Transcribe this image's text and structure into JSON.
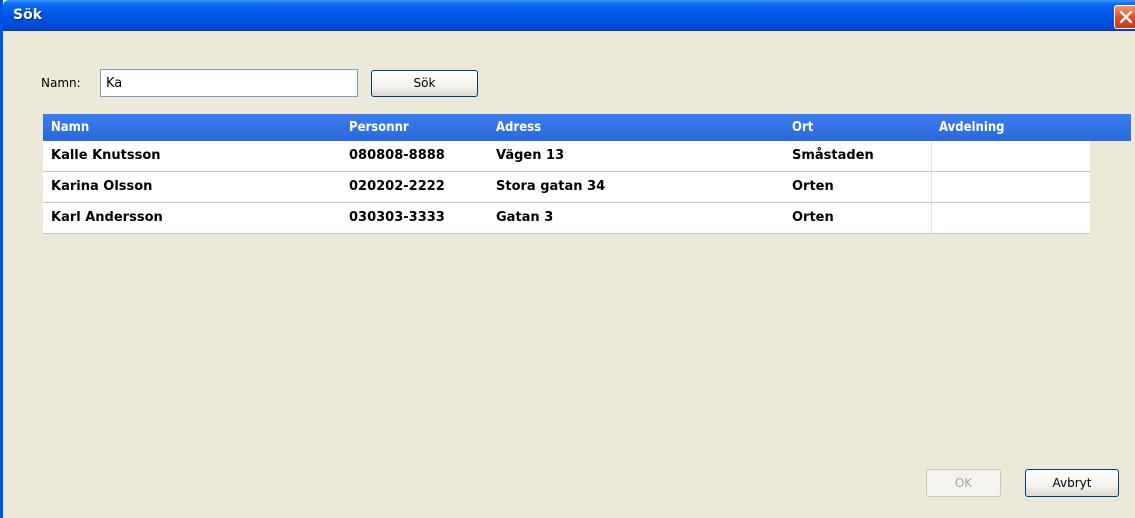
{
  "window": {
    "title": "Sök"
  },
  "search": {
    "label": "Namn:",
    "value": "Ka",
    "button_label": "Sök"
  },
  "table": {
    "columns": [
      "Namn",
      "Personnr",
      "Adress",
      "Ort",
      "Avdelning"
    ],
    "rows": [
      [
        "Kalle Knutsson",
        "080808-8888",
        "Vägen 13",
        "Småstaden",
        ""
      ],
      [
        "Karina Olsson",
        "020202-2222",
        "Stora gatan 34",
        "Orten",
        ""
      ],
      [
        "Karl Andersson",
        "030303-3333",
        "Gatan 3",
        "Orten",
        ""
      ]
    ]
  },
  "footer": {
    "ok_label": "OK",
    "ok_enabled": false,
    "cancel_label": "Avbryt"
  },
  "colors": {
    "titlebar": "#0055e5",
    "header": "#2f6fe0",
    "dialog_bg": "#ece9d8"
  }
}
